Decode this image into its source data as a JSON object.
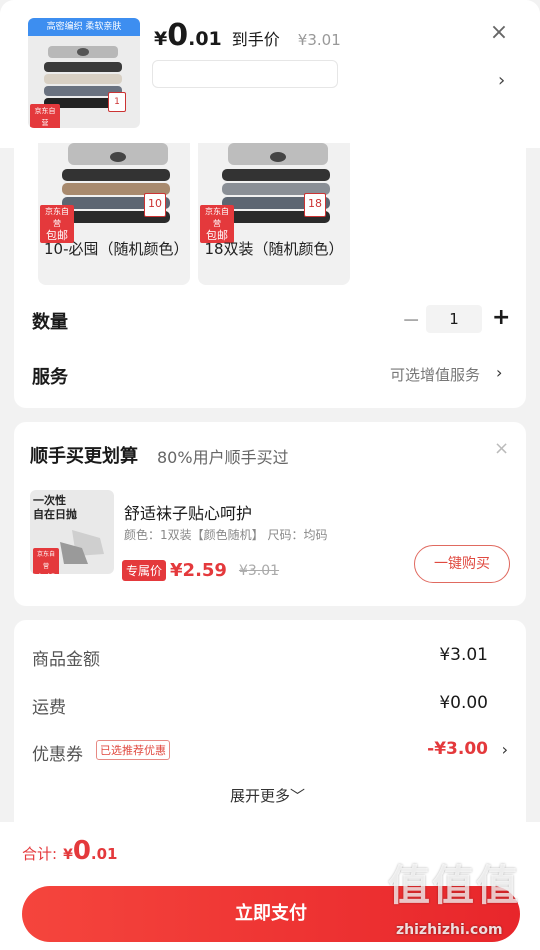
{
  "header": {
    "thumb_banner": "高密编织 柔软亲肤",
    "thumb_badge_line1": "京东自营",
    "thumb_badge_line2": "包邮",
    "thumb_count": "1",
    "price_symbol": "¥",
    "price_int": "0",
    "price_dec": ".01",
    "price_after_label": "到手价",
    "price_original": "¥3.01",
    "close_glyph": "×",
    "chevron_glyph": "›"
  },
  "variants": [
    {
      "label": "10-必囤（随机颜色）",
      "badge_line1": "京东自营",
      "badge_line2": "包邮",
      "count": "10"
    },
    {
      "label": "18双装（随机颜色）",
      "badge_line1": "京东自营",
      "badge_line2": "包邮",
      "count": "18"
    }
  ],
  "quantity": {
    "label": "数量",
    "minus": "−",
    "value": "1",
    "plus": "+"
  },
  "service": {
    "label": "服务",
    "value": "可选增值服务",
    "chevron": "›"
  },
  "addon": {
    "title": "顺手买更划算",
    "subtitle": "80%用户顺手买过",
    "close": "×",
    "img_text_line1": "一次性",
    "img_text_line2": "自在日抛",
    "img_badge_line1": "京东自营",
    "img_badge_line2": "包邮",
    "name": "舒适袜子贴心呵护",
    "spec": "颜色：1双装【颜色随机】   尺码：均码",
    "exclusive_tag": "专属价",
    "price": "¥2.59",
    "original_price": "¥3.01",
    "buy_button": "一键购买"
  },
  "summary": {
    "goods_label": "商品金额",
    "goods_value": "¥3.01",
    "shipping_label": "运费",
    "shipping_value": "¥0.00",
    "coupon_label": "优惠券",
    "coupon_tag": "已选推荐优惠",
    "coupon_value": "-¥3.00",
    "coupon_chevron": "›",
    "expand_label": "展开更多﹀"
  },
  "bottom": {
    "total_label": "合计:",
    "total_symbol": "¥",
    "total_int": "0",
    "total_dec": ".01",
    "pay_button": "立即支付"
  },
  "watermark": {
    "chars": "值值值",
    "url": "zhizhizhi.com"
  },
  "colors": {
    "accent_red": "#e4393c",
    "banner_blue": "#3d8ef0"
  }
}
